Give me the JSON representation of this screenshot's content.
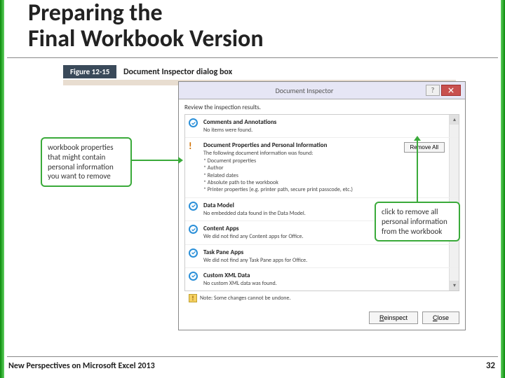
{
  "slide": {
    "title_line1": "Preparing the",
    "title_line2": "Final Workbook Version"
  },
  "figure": {
    "label": "Figure 12-15",
    "caption": "Document Inspector dialog box"
  },
  "dialog": {
    "title": "Document Inspector",
    "review": "Review the inspection results.",
    "remove_all": "Remove All",
    "note": "Note: Some changes cannot be undone.",
    "reinspect": "Reinspect",
    "close": "Close",
    "items": [
      {
        "icon": "check",
        "title": "Comments and Annotations",
        "desc": "No items were found."
      },
      {
        "icon": "warn",
        "title": "Document Properties and Personal Information",
        "desc": "The following document information was found:",
        "bullets": [
          "Document properties",
          "Author",
          "Related dates",
          "Absolute path to the workbook",
          "Printer properties (e.g. printer path, secure print passcode, etc.)"
        ],
        "remove": true
      },
      {
        "icon": "check",
        "title": "Data Model",
        "desc": "No embedded data found in the Data Model."
      },
      {
        "icon": "check",
        "title": "Content Apps",
        "desc": "We did not find any Content apps for Office."
      },
      {
        "icon": "check",
        "title": "Task Pane Apps",
        "desc": "We did not find any Task Pane apps for Office."
      },
      {
        "icon": "check",
        "title": "Custom XML Data",
        "desc": "No custom XML data was found."
      }
    ]
  },
  "callouts": {
    "left": "workbook properties that might contain personal information you want to remove",
    "right": "click to remove all personal information from the workbook"
  },
  "footer": {
    "text": "New Perspectives on Microsoft Excel 2013",
    "page": "32"
  }
}
